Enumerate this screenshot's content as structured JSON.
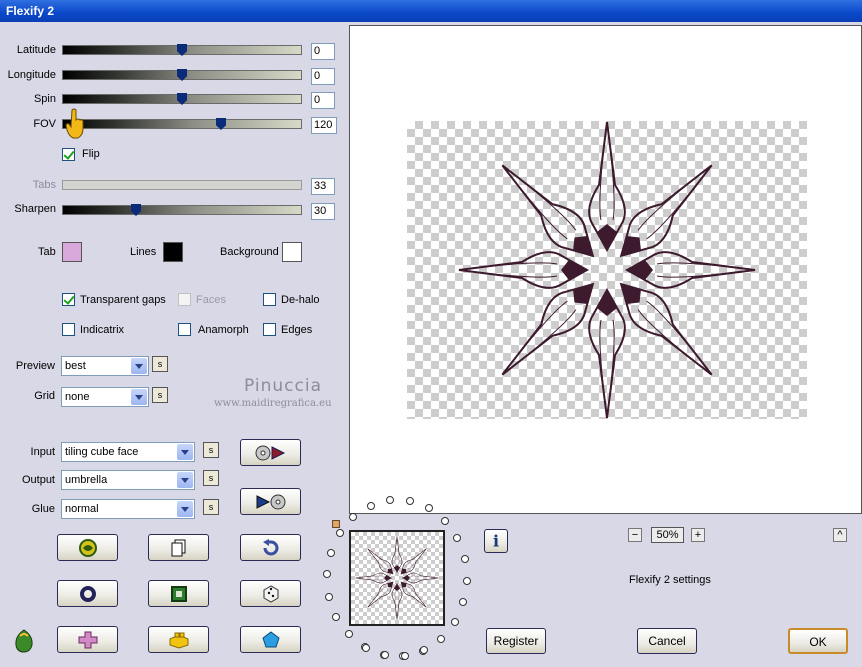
{
  "window": {
    "title": "Flexify 2"
  },
  "sliders": [
    {
      "label": "Latitude",
      "value": "0",
      "level": 0.5,
      "enabled": true
    },
    {
      "label": "Longitude",
      "value": "0",
      "level": 0.5,
      "enabled": true
    },
    {
      "label": "Spin",
      "value": "0",
      "level": 0.5,
      "enabled": true
    },
    {
      "label": "FOV",
      "value": "120",
      "level": 0.67,
      "enabled": true
    },
    {
      "label": "Tabs",
      "value": "33",
      "level": 0,
      "enabled": false
    },
    {
      "label": "Sharpen",
      "value": "30",
      "level": 0.3,
      "enabled": true
    }
  ],
  "flip": {
    "label": "Flip",
    "checked": true
  },
  "colors": {
    "tab": {
      "label": "Tab",
      "color": "#d9a9dc"
    },
    "lines": {
      "label": "Lines",
      "color": "#000000"
    },
    "background": {
      "label": "Background",
      "color": "#ffffff"
    }
  },
  "options": {
    "transparent_gaps": {
      "label": "Transparent gaps",
      "checked": true,
      "enabled": true
    },
    "faces": {
      "label": "Faces",
      "checked": false,
      "enabled": false
    },
    "dehalo": {
      "label": "De-halo",
      "checked": false,
      "enabled": true
    },
    "indicatrix": {
      "label": "Indicatrix",
      "checked": false,
      "enabled": true
    },
    "anamorph": {
      "label": "Anamorph",
      "checked": false,
      "enabled": true
    },
    "edges": {
      "label": "Edges",
      "checked": false,
      "enabled": true
    }
  },
  "dropdowns": {
    "preview": {
      "label": "Preview",
      "value": "best"
    },
    "grid": {
      "label": "Grid",
      "value": "none"
    },
    "input": {
      "label": "Input",
      "value": "tiling cube face"
    },
    "output": {
      "label": "Output",
      "value": "umbrella"
    },
    "glue": {
      "label": "Glue",
      "value": "normal"
    }
  },
  "small_button_label": "s",
  "watermark": {
    "name": "Pinuccia",
    "url": "www.maidiregrafica.eu"
  },
  "zoom": {
    "value": "50%",
    "minus": "−",
    "plus": "+"
  },
  "settings_text": "Flexify 2 settings",
  "info_label": "i",
  "scroll_up": "^",
  "buttons": {
    "register": "Register",
    "cancel": "Cancel",
    "ok": "OK"
  },
  "accent": {
    "star": "#3d1a2e",
    "title_bar": "#0a48c9",
    "thumb": "#0a2a7a"
  }
}
